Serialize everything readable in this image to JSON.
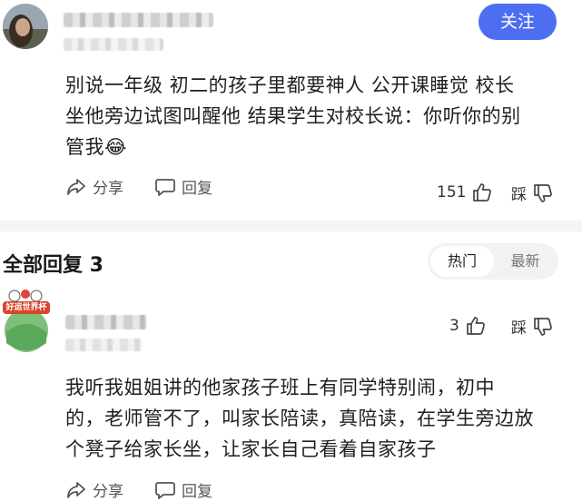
{
  "comment": {
    "follow_label": "关注",
    "body_line1": "别说一年级 初二的孩子里都要神人 公开课睡觉 校长",
    "body_line2": "坐他旁边试图叫醒他 结果学生对校长说：你听你的别",
    "body_line3": "管我",
    "body_emoji": "😂",
    "share_label": "分享",
    "reply_label": "回复",
    "like_count": "151",
    "dislike_label": "踩"
  },
  "replies_header": {
    "title": "全部回复 3",
    "tab_hot": "热门",
    "tab_latest": "最新"
  },
  "reply": {
    "badge_text": "好运世界杯",
    "like_count": "3",
    "dislike_label": "踩",
    "body_line1": "我听我姐姐讲的他家孩子班上有同学特别闹，初中",
    "body_line2": "的，老师管不了，叫家长陪读，真陪读，在学生旁边放",
    "body_line3": "个凳子给家长坐，让家长自己看着自家孩子",
    "share_label": "分享",
    "reply_label": "回复"
  },
  "colors": {
    "accent": "#4e6ef2",
    "divider": "#f5f5f5"
  }
}
